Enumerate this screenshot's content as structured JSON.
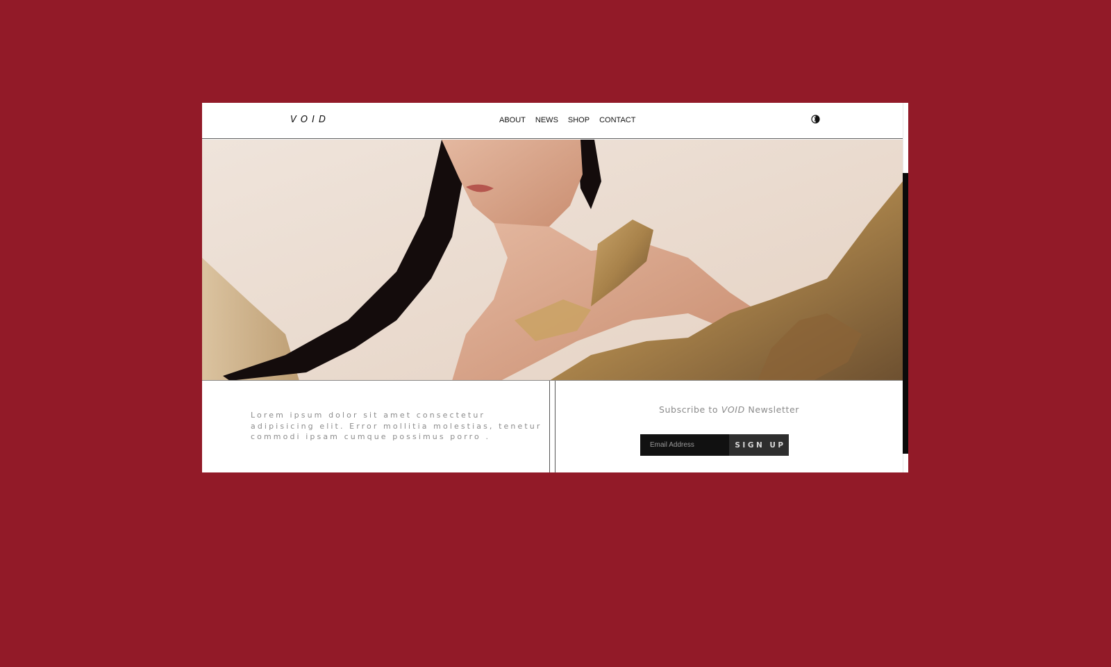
{
  "header": {
    "logo": "VOID",
    "nav": [
      "ABOUT",
      "NEWS",
      "SHOP",
      "CONTACT"
    ],
    "theme_toggle_icon": "contrast-icon"
  },
  "hero": {
    "image_alt": "photo"
  },
  "intro": {
    "text": "Lorem ipsum dolor sit amet consectetur adipisicing elit. Error mollitia molestias, tenetur commodi ipsam cumque possimus porro ."
  },
  "newsletter": {
    "title_prefix": "Subscribe to ",
    "title_brand": "VOID",
    "title_suffix": " Newsletter",
    "email_placeholder": "Email Address",
    "email_value": "",
    "button_label": "SIGN UP"
  },
  "colors": {
    "page_background": "#921a28",
    "site_background": "#ffffff",
    "input_background": "#111111",
    "button_background": "#2e2e2e"
  }
}
